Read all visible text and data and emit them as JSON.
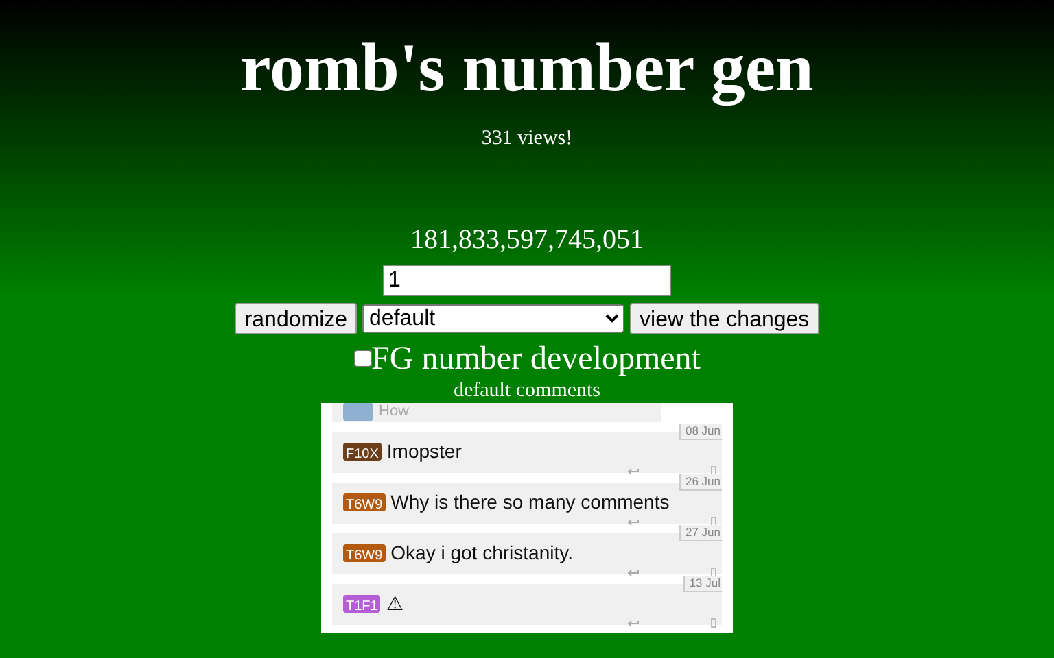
{
  "title": "romb's number gen",
  "views": "331 views!",
  "number": "181,833,597,745,051",
  "seed_input": {
    "value": "1"
  },
  "buttons": {
    "randomize": "randomize",
    "mode": {
      "value": "default"
    },
    "view": "view the changes"
  },
  "toggle": {
    "label": "FG number development",
    "checked": false
  },
  "comments_heading": "default comments",
  "comments": [
    {
      "kind": "partial",
      "color": "#8fb0d0",
      "text": "How"
    },
    {
      "kind": "full",
      "tag": "F10X",
      "color": "#6b3f1c",
      "text": "Imopster",
      "date": "08 Jun"
    },
    {
      "kind": "full",
      "tag": "T6W9",
      "color": "#b35a10",
      "text": "Why is there so many comments",
      "date": "26 Jun"
    },
    {
      "kind": "full",
      "tag": "T6W9",
      "color": "#b35a10",
      "text": "Okay i got christanity.",
      "date": "27 Jun"
    },
    {
      "kind": "full",
      "tag": "T1F1",
      "color": "#b55fd6",
      "text": "⚠",
      "date": "13 Jul"
    }
  ]
}
